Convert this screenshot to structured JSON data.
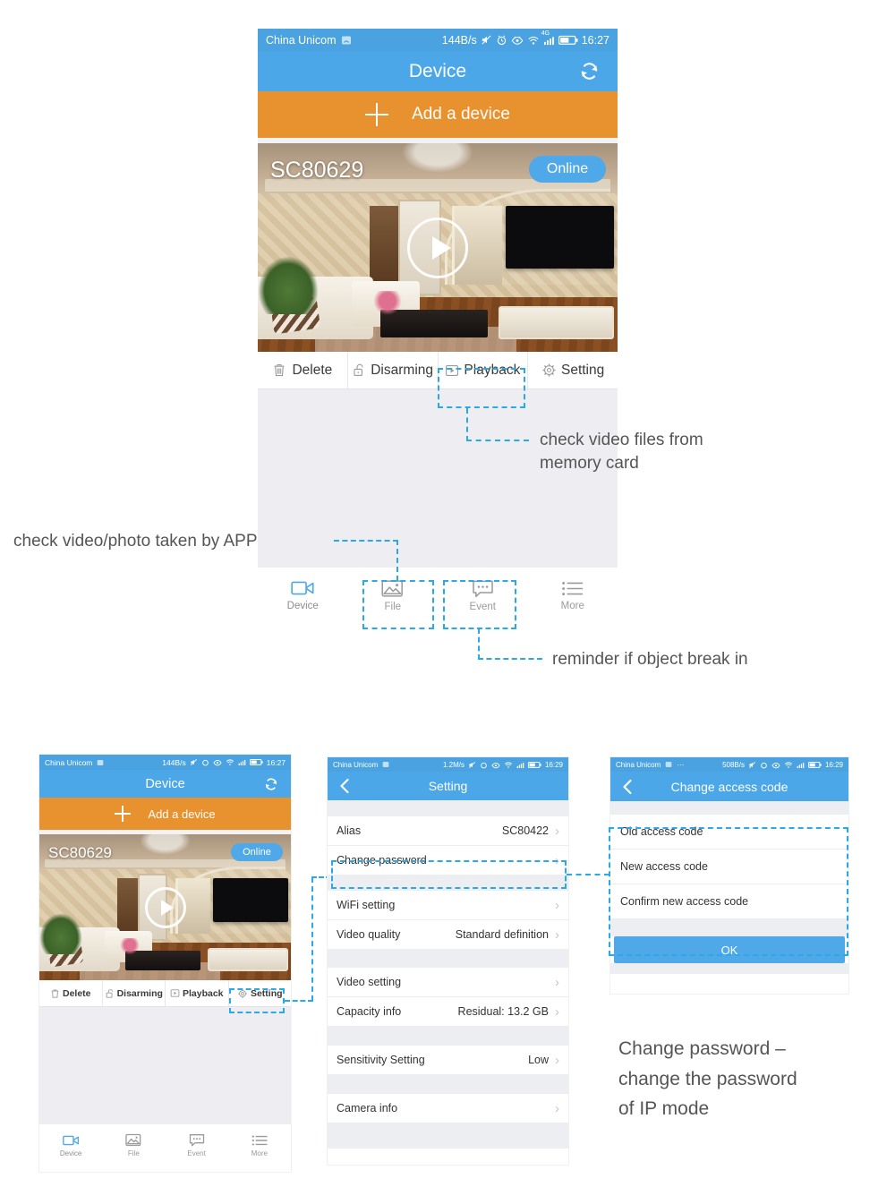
{
  "top_phone": {
    "status_bar": {
      "carrier": "China Unicom",
      "speed": "144B/s",
      "network": "4G",
      "time": "16:27",
      "icons": [
        "sim-icon",
        "mute-icon",
        "alarm-icon",
        "eye-icon",
        "wifi-icon",
        "signal-icon",
        "battery-icon"
      ]
    },
    "nav": {
      "title": "Device",
      "refresh_icon": "refresh-icon"
    },
    "add_bar": {
      "label": "Add a device",
      "plus_icon": "plus-icon"
    },
    "camera_card": {
      "name": "SC80629",
      "status": "Online",
      "play_icon": "play-icon"
    },
    "actions": [
      {
        "label": "Delete",
        "icon": "trash-icon"
      },
      {
        "label": "Disarming",
        "icon": "unlock-icon"
      },
      {
        "label": "Playback",
        "icon": "play-box-icon"
      },
      {
        "label": "Setting",
        "icon": "gear-icon"
      }
    ],
    "tabs": [
      {
        "label": "Device",
        "icon": "video-camera-icon",
        "active": true
      },
      {
        "label": "File",
        "icon": "photo-icon",
        "active": false
      },
      {
        "label": "Event",
        "icon": "chat-bubble-icon",
        "active": false
      },
      {
        "label": "More",
        "icon": "list-icon",
        "active": false
      }
    ]
  },
  "annotations": {
    "playback": "check video files from\nmemory card",
    "file": "check video/photo taken by APP",
    "event": "reminder if object break in",
    "change_password": "Change password –\nchange the password\nof IP mode"
  },
  "bottom_phone_1": {
    "status_bar": {
      "carrier": "China Unicom",
      "speed": "144B/s",
      "time": "16:27"
    },
    "nav": {
      "title": "Device",
      "refresh_icon": "refresh-icon"
    },
    "add_bar": {
      "label": "Add a device"
    },
    "camera_card": {
      "name": "SC80629",
      "status": "Online"
    },
    "actions": [
      {
        "label": "Delete",
        "icon": "trash-icon"
      },
      {
        "label": "Disarming",
        "icon": "unlock-icon"
      },
      {
        "label": "Playback",
        "icon": "play-box-icon"
      },
      {
        "label": "Setting",
        "icon": "gear-icon"
      }
    ],
    "tabs": [
      {
        "label": "Device",
        "icon": "video-camera-icon"
      },
      {
        "label": "File",
        "icon": "photo-icon"
      },
      {
        "label": "Event",
        "icon": "chat-bubble-icon"
      },
      {
        "label": "More",
        "icon": "list-icon"
      }
    ]
  },
  "bottom_phone_2": {
    "status_bar": {
      "carrier": "China Unicom",
      "speed": "1.2M/s",
      "time": "16:29"
    },
    "nav": {
      "title": "Setting",
      "back_icon": "chevron-left-icon"
    },
    "rows": [
      {
        "label": "Alias",
        "value": "SC80422"
      },
      {
        "label": "Change password",
        "value": ""
      },
      {
        "label": "WiFi setting",
        "value": ""
      },
      {
        "label": "Video quality",
        "value": "Standard definition"
      },
      {
        "label": "Video setting",
        "value": ""
      },
      {
        "label": "Capacity info",
        "value": "Residual:  13.2 GB"
      },
      {
        "label": "Sensitivity Setting",
        "value": "Low"
      },
      {
        "label": "Camera info",
        "value": ""
      }
    ]
  },
  "bottom_phone_3": {
    "status_bar": {
      "carrier": "China Unicom",
      "speed": "508B/s",
      "time": "16:29"
    },
    "nav": {
      "title": "Change access code",
      "back_icon": "chevron-left-icon"
    },
    "fields": [
      {
        "placeholder": "Old access code"
      },
      {
        "placeholder": "New access code"
      },
      {
        "placeholder": "Confirm new access code"
      }
    ],
    "ok_label": "OK"
  },
  "colors": {
    "nav_blue": "#4ba7e8",
    "status_blue": "#4aa3e0",
    "orange": "#e8922f",
    "accent_dash": "#29a9e8",
    "page_bg": "#eeeef2"
  }
}
